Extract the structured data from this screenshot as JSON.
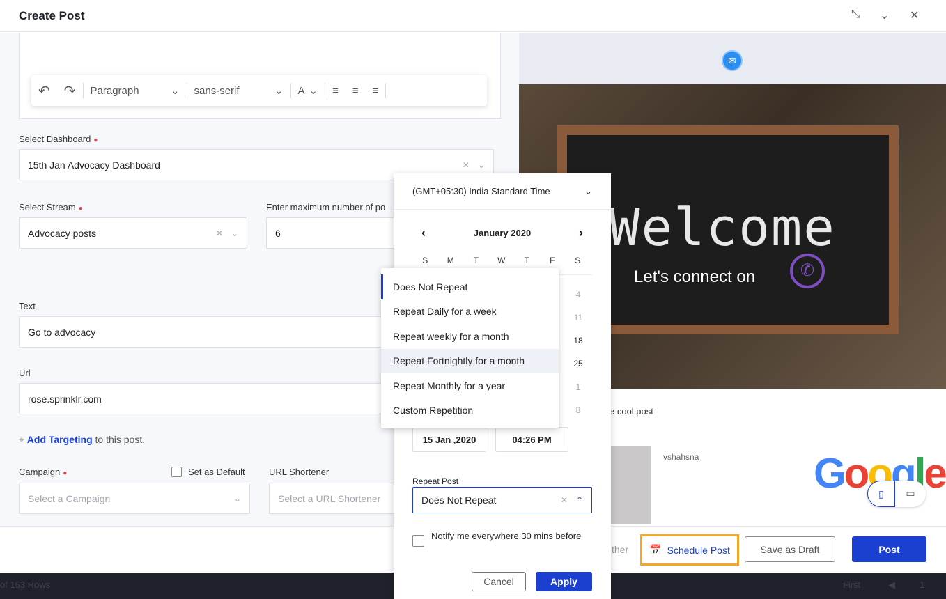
{
  "header": {
    "title": "Create Post"
  },
  "editor": {
    "undo": "↶",
    "redo": "↷",
    "paragraph": "Paragraph",
    "font": "sans-serif"
  },
  "form": {
    "dashboard_label": "Select Dashboard",
    "dashboard_value": "15th Jan Advocacy Dashboard",
    "stream_label": "Select Stream",
    "stream_value": "Advocacy posts",
    "max_label": "Enter maximum number of po",
    "max_value": "6",
    "text_label": "Text",
    "text_value": "Go to advocacy",
    "url_label": "Url",
    "url_value": "rose.sprinklr.com",
    "targeting_link": "Add Targeting",
    "targeting_suffix": "to this post.",
    "campaign_label": "Campaign",
    "campaign_placeholder": "Select a Campaign",
    "set_default": "Set as Default",
    "shortener_label": "URL Shortener",
    "shortener_placeholder": "Select a URL Shortener"
  },
  "preview": {
    "welcome": "Welcome",
    "connect": "Let's  connect on",
    "caption": "e cool post",
    "user": "vshahsna",
    "google": "Google"
  },
  "scheduler": {
    "timezone": "(GMT+05:30) India Standard Time",
    "month": "January 2020",
    "weekdays": [
      "S",
      "M",
      "T",
      "W",
      "T",
      "F",
      "S"
    ],
    "visible_saturdays": [
      "4",
      "11",
      "18",
      "25",
      "1",
      "8"
    ],
    "date": "15 Jan ,2020",
    "time": "04:26 PM",
    "repeat_label": "Repeat Post",
    "repeat_value": "Does Not Repeat",
    "notify": "Notify me everywhere 30 mins before",
    "cancel": "Cancel",
    "apply": "Apply"
  },
  "repeat_menu": [
    "Does Not Repeat",
    "Repeat Daily for a week",
    "Repeat weekly for a month",
    "Repeat Fortnightly for a month",
    "Repeat Monthly for a year",
    "Custom Repetition"
  ],
  "footer": {
    "other": "ther",
    "schedule": "Schedule Post",
    "draft": "Save as Draft",
    "post": "Post"
  },
  "darkbar": {
    "rows": "of 163 Rows",
    "first": "First",
    "page": "1"
  },
  "colors": {
    "primary": "#1a3fd1",
    "highlight": "#f5a623"
  }
}
